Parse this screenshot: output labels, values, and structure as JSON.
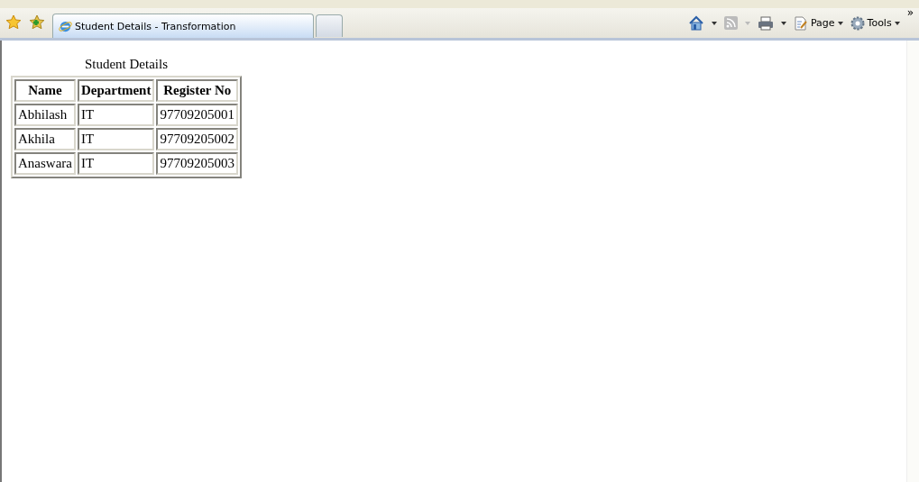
{
  "tab": {
    "title": "Student Details - Transformation",
    "selected": true
  },
  "toolbar": {
    "page_label": "Page",
    "tools_label": "Tools",
    "overflow": "»"
  },
  "table": {
    "caption": "Student Details",
    "columns": [
      "Name",
      "Department",
      "Register No"
    ],
    "rows": [
      [
        "Abhilash",
        "IT",
        "97709205001"
      ],
      [
        "Akhila",
        "IT",
        "97709205002"
      ],
      [
        "Anaswara",
        "IT",
        "97709205003"
      ]
    ]
  }
}
